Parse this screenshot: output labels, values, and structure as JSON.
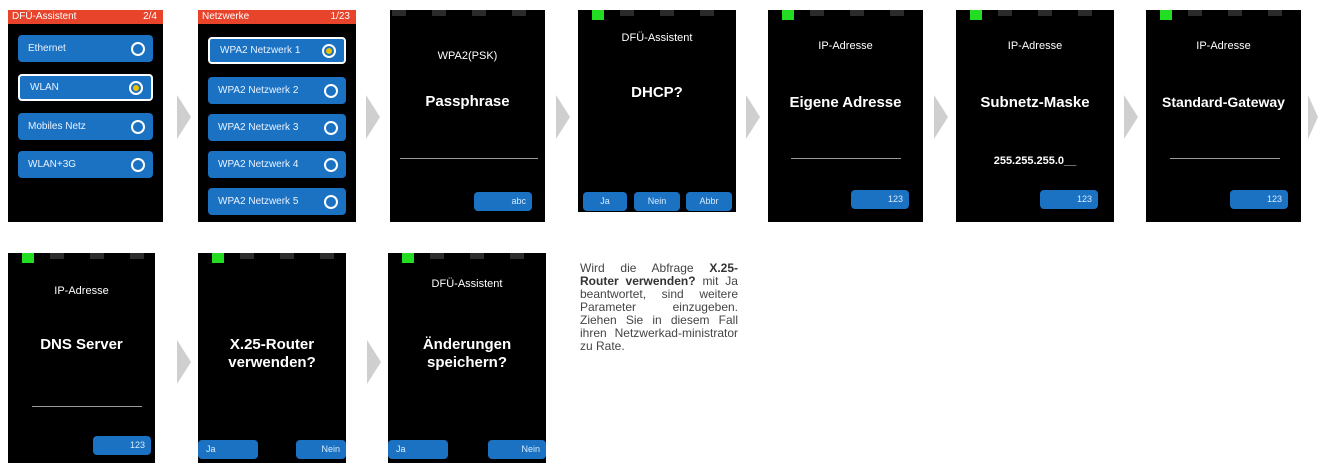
{
  "s1": {
    "header_title": "DFÜ-Assistent",
    "header_page": "2/4",
    "items": [
      {
        "label": "Ethernet",
        "selected": false
      },
      {
        "label": "WLAN",
        "selected": true
      },
      {
        "label": "Mobiles Netz",
        "selected": false
      },
      {
        "label": "WLAN+3G",
        "selected": false
      }
    ]
  },
  "s2": {
    "header_title": "Netzwerke",
    "header_page": "1/23",
    "items": [
      {
        "label": "WPA2 Netzwerk 1",
        "selected": true
      },
      {
        "label": "WPA2 Netzwerk 2",
        "selected": false
      },
      {
        "label": "WPA2 Netzwerk 3",
        "selected": false
      },
      {
        "label": "WPA2 Netzwerk 4",
        "selected": false
      },
      {
        "label": "WPA2 Netzwerk 5",
        "selected": false
      }
    ]
  },
  "s3": {
    "title": "WPA2(PSK)",
    "prompt": "Passphrase",
    "button": "abc"
  },
  "s4": {
    "title": "DFÜ-Assistent",
    "prompt": "DHCP?",
    "btn_yes": "Ja",
    "btn_no": "Nein",
    "btn_abort": "Abbr"
  },
  "s5": {
    "title": "IP-Adresse",
    "prompt": "Eigene Adresse",
    "button": "123"
  },
  "s6": {
    "title": "IP-Adresse",
    "prompt": "Subnetz-Maske",
    "value": "255.255.255.0__",
    "button": "123"
  },
  "s7": {
    "title": "IP-Adresse",
    "prompt": "Standard-Gateway",
    "button": "123"
  },
  "s8": {
    "title": "IP-Adresse",
    "prompt": "DNS Server",
    "button": "123"
  },
  "s9": {
    "prompt_line1": "X.25-Router",
    "prompt_line2": "verwenden?",
    "btn_yes": "Ja",
    "btn_no": "Nein"
  },
  "s10": {
    "title": "DFÜ-Assistent",
    "prompt_line1": "Änderungen",
    "prompt_line2": "speichern?",
    "btn_yes": "Ja",
    "btn_no": "Nein"
  },
  "note": {
    "part1": "Wird die Abfrage",
    "bold": "X.25-Router verwenden?",
    "part2": "mit Ja beantwortet, sind weitere Parameter einzugeben. Ziehen Sie in diesem Fall ihren Netzwerkad-ministrator zu Rate."
  },
  "colors": {
    "accent_blue": "#1b72c3",
    "header_red": "#e8442c",
    "status_green": "#22dd22",
    "radio_selected": "#f0c000"
  }
}
